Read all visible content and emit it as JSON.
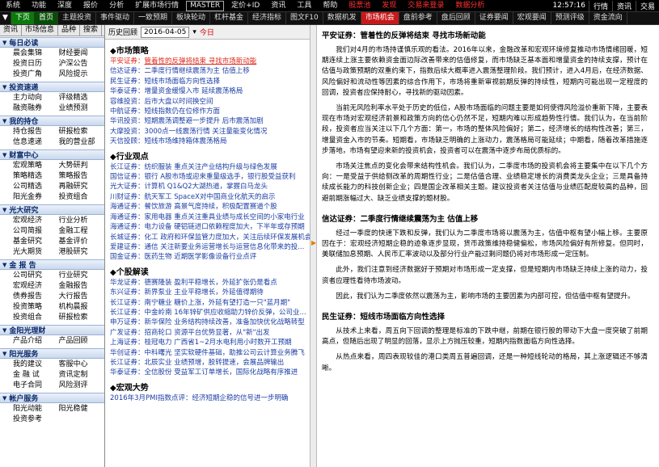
{
  "menubar": {
    "items": [
      "系统",
      "功能",
      "深度",
      "报价",
      "分析",
      "扩展市场行情",
      "MASTER",
      "定价+ID",
      "资讯",
      "工具",
      "帮助"
    ],
    "alerts": [
      "股票池",
      "发现"
    ],
    "promo": [
      "交易来登录",
      "数据分析"
    ],
    "clock": "12:57:16",
    "right_buttons": [
      "行情",
      "资讯",
      "交易"
    ]
  },
  "toolbar": {
    "items": [
      "下页",
      "首页",
      "主题投资",
      "事件驱动",
      "一致预期",
      "板块轮动",
      "杠杆基金",
      "经济指标",
      "图文F10",
      "数据机发",
      "市场机会",
      "盘前参考",
      "盘后回顾",
      "证券要闻",
      "宏观要闻",
      "预测评级",
      "资金流向"
    ],
    "active": "市场机会"
  },
  "left": {
    "tabs": [
      "资讯",
      "市场信息",
      "品种",
      "搜索"
    ],
    "sections": [
      {
        "title": "每日必读",
        "items": [
          "晨会集锦",
          "财经要闻",
          "投资日历",
          "沪深公告",
          "投资广角",
          "风险提示"
        ]
      },
      {
        "title": "投资速递",
        "items": [
          "主力动向",
          "评级精选",
          "融资融券",
          "业绩预测"
        ]
      },
      {
        "title": "我的持仓",
        "items": [
          "持仓报告",
          "研报检索",
          "信息速递",
          "我的营业部"
        ]
      },
      {
        "title": "财富中心",
        "items": [
          "宏观策略",
          "大势研判",
          "策略精选",
          "策略报告",
          "公司精选",
          "再融研究",
          "阳光金券",
          "投资组合"
        ]
      },
      {
        "title": "光大研究",
        "items": [
          "宏观经济",
          "行业分析",
          "公司简报",
          "金融工程",
          "基金研究",
          "基金评价",
          "光大期货",
          "港股研究"
        ]
      },
      {
        "title": "金 报 告",
        "items": [
          "公司研究",
          "行业研究",
          "宏观经济",
          "金融报告",
          "债券报告",
          "大行报告",
          "投资策略",
          "机构晨报",
          "投资组合",
          "研报检索"
        ]
      },
      {
        "title": "金阳光理财",
        "items": [
          "产品介绍",
          "产品回顾"
        ]
      },
      {
        "title": "阳光服务",
        "items": [
          "我的建议",
          "客服中心",
          "金 融 试",
          "资讯定制",
          "电子合同",
          "风险测评"
        ]
      },
      {
        "title": "帐户服务",
        "items": [
          "阳光动能",
          "阳光稳健",
          "投资参考"
        ]
      }
    ]
  },
  "mid": {
    "history_label": "历史回顾",
    "date": "2016-04-05",
    "today": "今日",
    "groups": [
      {
        "title": "市场策略",
        "rows": [
          {
            "src": "平安证券",
            "ttl": "管着性的反弹将结束 寻找市场新动能",
            "red": true
          },
          {
            "src": "信达证券",
            "ttl": "二季度行情继续震荡为主 估值上移",
            "red": false
          },
          {
            "src": "民生证券",
            "ttl": "短线市场面临方向性选择",
            "red": false
          },
          {
            "src": "华泰证券",
            "ttl": "增量资金缓慢入市 延续震荡格局",
            "red": false
          },
          {
            "src": "容维投资",
            "ttl": "后市大盘以时间换空间",
            "red": false
          },
          {
            "src": "中航证券",
            "ttl": "短线指数仍在位修作方面",
            "red": false
          },
          {
            "src": "华讯投资",
            "ttl": "短期震荡调整避一步提升 后市震荡加剧",
            "red": false
          },
          {
            "src": "大摩投资",
            "ttl": "3000点一线震荡行情 关注量能变化情况",
            "red": false
          },
          {
            "src": "天信投顾",
            "ttl": "短线市场维持箱体震荡格局",
            "red": false
          }
        ]
      },
      {
        "title": "行业观点",
        "rows": [
          {
            "src": "长江证券",
            "ttl": "纺织服装 重点关注产业结构升级与绿色发展",
            "red": false
          },
          {
            "src": "国信证券",
            "ttl": "银行 A股市场或迎来重量级选手，银行股受益获利",
            "red": false
          },
          {
            "src": "光大证券",
            "ttl": "计算机 Q1&Q2大湖热道，掌握白马龙头",
            "red": false
          },
          {
            "src": "川财证券",
            "ttl": "航天军工 SpaceX对中国商业化航天的启示",
            "red": false
          },
          {
            "src": "海通证券",
            "ttl": "餐饮旅游 高景气度持续，积极配置赛道个股",
            "red": false
          },
          {
            "src": "海通证券",
            "ttl": "家用电器 重点关注重具业绩与成长空间的小家电行业",
            "red": false
          },
          {
            "src": "海通证券",
            "ttl": "电力设备 硬铝链进口依赖程度加大，下半年或存预期",
            "red": false
          },
          {
            "src": "长城证券",
            "ttl": "化工 政府和环保监管力度加大，关注后续环保发展机会",
            "red": false
          },
          {
            "src": "爱建证券",
            "ttl": "通信 关注新要业务运营增长与运营信息化带来的投...",
            "red": false
          },
          {
            "src": "国金证券",
            "ttl": "医药生物 近期医学影像设备行业点评",
            "red": false
          }
        ]
      },
      {
        "title": "个股解读",
        "rows": [
          {
            "src": "华龙证券",
            "ttl": "德赛隆装 盈利平稳增长，外延扩张仍是看点",
            "red": false
          },
          {
            "src": "东兴证券",
            "ttl": "新界泵业 主业平稳增长，外延值得期待",
            "red": false
          },
          {
            "src": "长江证券",
            "ttl": "南宁糖业 糖价上涨，外延有望打造一只\"蓝月期\"",
            "red": false
          },
          {
            "src": "长江证券",
            "ttl": "中金岭南 16年锌矿供应收缩助力锌价反弹，公司业...",
            "red": false
          },
          {
            "src": "申万证券",
            "ttl": "新华保险 业务结构持续改善，准备加快优化战略转型",
            "red": false
          },
          {
            "src": "广发证券",
            "ttl": "招商轮口 资源平台优势显著，从\"新\"出发",
            "red": false
          },
          {
            "src": "上海证券",
            "ttl": "桂冠电力 广西省1~2月水电利用小时数开工预期",
            "red": false
          },
          {
            "src": "华创证券",
            "ttl": "中科曙光 坚实软硬件基础，助推公司云计算业务腾飞",
            "red": false
          },
          {
            "src": "长江证券",
            "ttl": "北辰实业 业绩预增，股转提速，会展品牌输出",
            "red": false
          },
          {
            "src": "华泰证券",
            "ttl": "全信股份 受益军工订单增长，国际化战略有序推进",
            "red": false
          }
        ]
      },
      {
        "title": "宏观大势",
        "rows": [
          {
            "src": "",
            "ttl": "2016年3月PMI指数点评：经济短期企稳的信号进一步明确",
            "red": false
          }
        ]
      }
    ]
  },
  "article": {
    "title1": "平安证券：管着性的反弹将结束 寻找市场新动能",
    "paras1": [
      "我们对4月的市场持谨慎乐观的看法。2016年以来，金融改革和宏观环境修复推动市场情绪回暖，短期连续上涨主要依赖资金面边际改善带来的估值修复，而市场缺乏基本面和增量资金的持续支撑，预计在估值与政策预期的双重约束下，指数后续大概率进入震荡整理阶段。我们预计，进入4月后，在经济数据、风险偏好和流动性等因素的综合作用下，市场将重新审视前期反弹的持续性，短期内可能出现一定程度的回调，投资者应保持耐心，寻找新的驱动因素。",
      "当前无风险利率水平处于历史的低位，A股市场面临的问题主要是如何使得风险溢价重新下降，主要表现在市场对宏观经济前景和政策方向的信心仍然不足，短期内难以形成趋势性行情。我们认为，在当前阶段，投资者应当关注以下几个方面：第一，市场的整体风险偏好；第二，经济增长的结构性改善；第三，增量资金入市的节奏。短期看，市场缺乏明确的上涨动力，震荡格局可能延续；中期看，随着改革措施逐步落地，市场有望迎来新的投资机会，投资者可以在震荡中逐步布局优质标的。",
      "市场关注焦点的变化会带来结构性机会。我们认为，二季度市场的投资机会将主要集中在以下几个方向：一是受益于供给侧改革的周期性行业；二是估值合理、业绩稳定增长的消费类龙头企业；三是具备持续成长能力的科技创新企业；四是国企改革相关主题。建议投资者关注估值与业绩匹配度较高的品种，回避前期涨幅过大、缺乏业绩支撑的题材股。"
    ],
    "title2": "信达证券：二季度行情继续震荡为主 估值上移",
    "paras2": [
      "经过一季度的快速下跌和反弹，我们认为二季度市场将以震荡为主，估值中枢有望小幅上移。主要原因在于：宏观经济短期企稳的迹象逐步显现，货币政策维持稳健偏松，市场风险偏好有所修复。但同时，美联储加息预期、人民币汇率波动以及部分行业产能过剩问题仍将对市场形成一定压制。",
      "此外，我们注意到经济数据好于预期对市场形成一定支撑，但是短期内市场缺乏持续上涨的动力，投资者应理性看待市场波动。",
      "因此，我们认为二季度依然以震荡为主，影响市场的主要因素为内部可控，但估值中枢有望提升。"
    ],
    "title3": "民生证券：短线市场面临方向性选择",
    "paras3": [
      "从技术上来看，周五向下回调的整理是标准的下跌中继，前期在银行股的带动下大盘一度突破了前期高点，但随后出现了明显的回落，显示上方抛压较重，短期内指数面临方向性选择。",
      "从热点来看，周四表现较佳的港口类周五普遍回调，还是一种短线轮动的格局，其上涨逻辑还不够清晰。"
    ]
  }
}
